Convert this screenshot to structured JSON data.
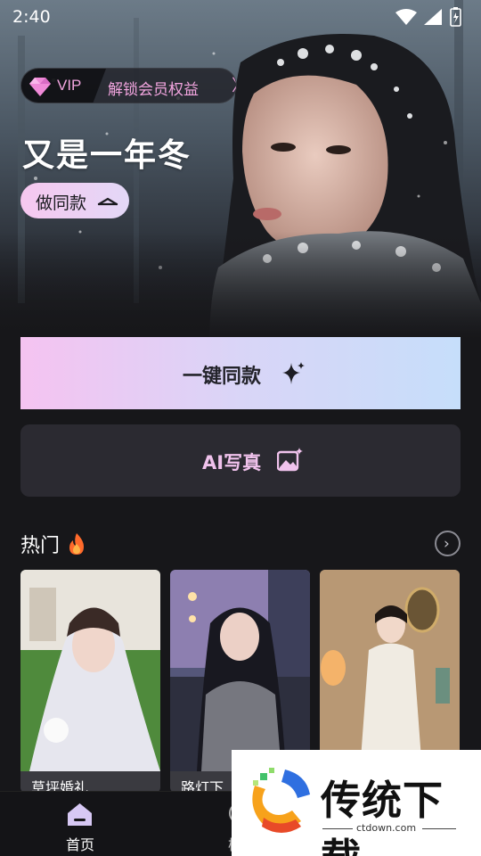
{
  "status_bar": {
    "time": "2:40"
  },
  "banner": {
    "vip_label": "VIP",
    "vip_text": "解锁会员权益",
    "vip_arrow": "〉",
    "title": "又是一年冬",
    "same_style_button": "做同款"
  },
  "actions": {
    "one_key_label": "一键同款",
    "ai_photo_label": "AI写真"
  },
  "hot": {
    "title": "热门",
    "more_arrow": "›",
    "cards": [
      {
        "caption": "草坪婚礼"
      },
      {
        "caption": "路灯下"
      },
      {
        "caption": ""
      }
    ]
  },
  "bottom_nav": {
    "items": [
      {
        "label": "首页",
        "active": true
      },
      {
        "label": "模",
        "active": false
      }
    ]
  },
  "watermark": {
    "title": "传统下载",
    "url": "ctdown.com"
  },
  "colors": {
    "background": "#17171a",
    "accent_pink": "#f2a5df",
    "gradient_start": "#f5c3f1",
    "gradient_end": "#c6defa"
  }
}
